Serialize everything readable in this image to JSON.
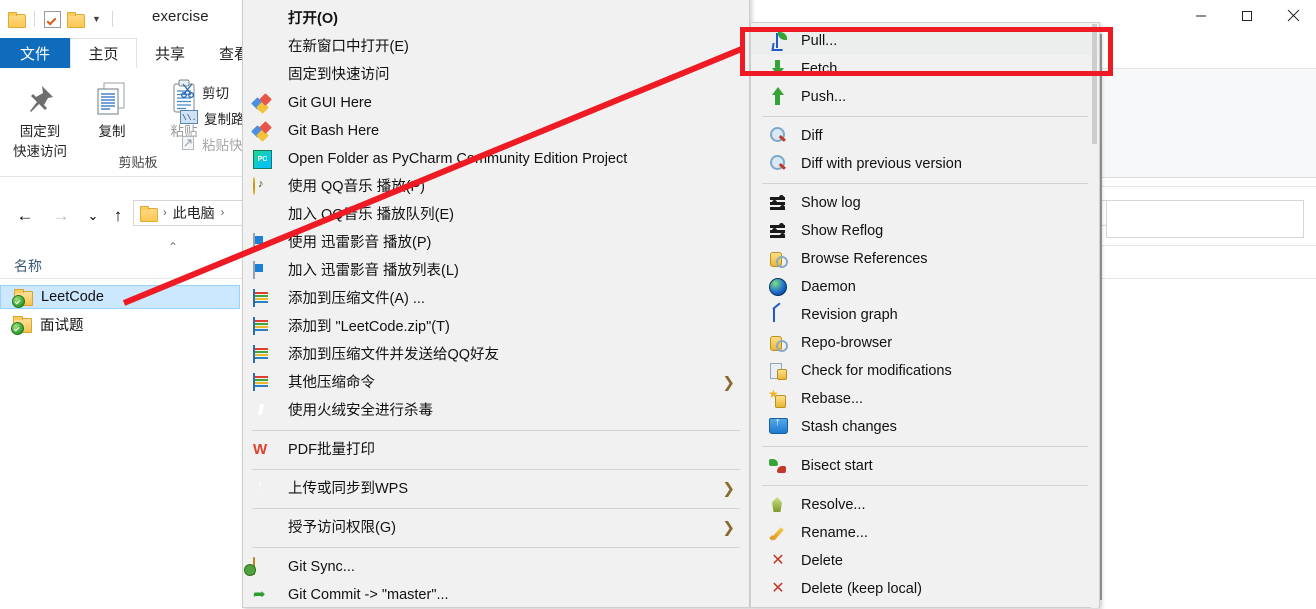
{
  "window": {
    "title": "exercise",
    "quick_access_icons": [
      "folder-icon",
      "properties-checkbox-icon",
      "new-folder-icon",
      "customize-caret-icon"
    ],
    "controls": {
      "minimize": "minimize-icon",
      "maximize": "maximize-icon",
      "close": "close-icon"
    },
    "help_label": "?",
    "ribbon_collapse": "ribbon-collapse-chevron"
  },
  "ribbon": {
    "tabs": [
      {
        "label": "文件",
        "active": false,
        "is_file_tab": true
      },
      {
        "label": "主页",
        "active": true
      },
      {
        "label": "共享",
        "active": false
      },
      {
        "label": "查看",
        "active": false
      }
    ],
    "clipboard_group": {
      "caption": "剪贴板",
      "big_buttons": [
        {
          "label_line1": "固定到",
          "label_line2": "快速访问",
          "icon": "pin-icon",
          "enabled": true
        },
        {
          "label_line1": "复制",
          "label_line2": "",
          "icon": "copy-icon",
          "enabled": true
        },
        {
          "label_line1": "粘贴",
          "label_line2": "",
          "icon": "paste-icon",
          "enabled": false
        }
      ],
      "small_buttons": [
        {
          "label": "剪切",
          "icon": "scissors-icon",
          "enabled": true
        },
        {
          "label": "复制路径",
          "icon": "copy-path-icon",
          "enabled": true
        },
        {
          "label": "粘贴快捷方式",
          "icon": "paste-shortcut-icon",
          "enabled": false
        }
      ]
    }
  },
  "navigation": {
    "back": "←",
    "forward": "→",
    "recent": "⌄",
    "up": "↑",
    "breadcrumb": [
      "此电脑"
    ],
    "breadcrumb_separator": "›"
  },
  "file_list": {
    "column_header": "名称",
    "rows": [
      {
        "name": "LeetCode",
        "selected": true,
        "icon": "svn-folder-icon"
      },
      {
        "name": "面试题",
        "selected": false,
        "icon": "svn-folder-icon"
      }
    ]
  },
  "context_menu": {
    "items": [
      {
        "label": "打开(O)",
        "bold": true,
        "icon": null
      },
      {
        "label": "在新窗口中打开(E)",
        "icon": null
      },
      {
        "label": "固定到快速访问",
        "icon": null
      },
      {
        "label": "Git GUI Here",
        "icon": "git-icon"
      },
      {
        "label": "Git Bash Here",
        "icon": "git-icon"
      },
      {
        "label": "Open Folder as PyCharm Community Edition Project",
        "icon": "pycharm-icon"
      },
      {
        "label": "使用 QQ音乐 播放(P)",
        "icon": "qqmusic-icon"
      },
      {
        "label": "加入 QQ音乐 播放队列(E)",
        "icon": null
      },
      {
        "label": "使用 迅雷影音 播放(P)",
        "icon": "xunlei-icon"
      },
      {
        "label": "加入 迅雷影音 播放列表(L)",
        "icon": "xunlei-icon"
      },
      {
        "label": "添加到压缩文件(A) ...",
        "icon": "winrar-icon"
      },
      {
        "label": "添加到 \"LeetCode.zip\"(T)",
        "icon": "winrar-icon"
      },
      {
        "label": "添加到压缩文件并发送给QQ好友",
        "icon": "winrar-icon"
      },
      {
        "label": "其他压缩命令",
        "icon": "winrar-icon",
        "submenu": true
      },
      {
        "label": "使用火绒安全进行杀毒",
        "icon": "huorong-icon"
      },
      {
        "separator": true
      },
      {
        "label": "PDF批量打印",
        "icon": "wps-icon"
      },
      {
        "separator": true
      },
      {
        "label": "上传或同步到WPS",
        "icon": "wps-cloud-icon",
        "submenu": true
      },
      {
        "separator": true
      },
      {
        "label": "授予访问权限(G)",
        "icon": null,
        "submenu": true
      },
      {
        "separator": true
      },
      {
        "label": "Git Sync...",
        "icon": "git-sync-icon"
      },
      {
        "label": "Git Commit -> \"master\"...",
        "icon": "git-commit-icon"
      }
    ]
  },
  "tortoise_submenu": {
    "items": [
      {
        "label": "Pull...",
        "icon": "pull-icon",
        "highlighted": true
      },
      {
        "label": "Fetch...",
        "icon": "fetch-icon"
      },
      {
        "label": "Push...",
        "icon": "push-icon"
      },
      {
        "separator": true
      },
      {
        "label": "Diff",
        "icon": "diff-magnifier-icon"
      },
      {
        "label": "Diff with previous version",
        "icon": "diff-magnifier-icon"
      },
      {
        "separator": true
      },
      {
        "label": "Show log",
        "icon": "show-log-icon"
      },
      {
        "label": "Show Reflog",
        "icon": "show-log-icon"
      },
      {
        "label": "Browse References",
        "icon": "browse-references-icon"
      },
      {
        "label": "Daemon",
        "icon": "daemon-globe-icon"
      },
      {
        "label": "Revision graph",
        "icon": "revision-graph-icon"
      },
      {
        "label": "Repo-browser",
        "icon": "repo-browser-icon"
      },
      {
        "label": "Check for modifications",
        "icon": "check-modifications-icon"
      },
      {
        "label": "Rebase...",
        "icon": "rebase-icon"
      },
      {
        "label": "Stash changes",
        "icon": "stash-icon"
      },
      {
        "separator": true
      },
      {
        "label": "Bisect start",
        "icon": "bisect-icon"
      },
      {
        "separator": true
      },
      {
        "label": "Resolve...",
        "icon": "resolve-icon"
      },
      {
        "label": "Rename...",
        "icon": "rename-pencil-icon"
      },
      {
        "label": "Delete",
        "icon": "delete-x-icon"
      },
      {
        "label": "Delete (keep local)",
        "icon": "delete-x-icon"
      }
    ]
  },
  "annotation": {
    "highlight_color": "#ee1b24",
    "highlight_target": "Pull...",
    "arrow_from": "LeetCode",
    "arrow_to": "Pull..."
  }
}
